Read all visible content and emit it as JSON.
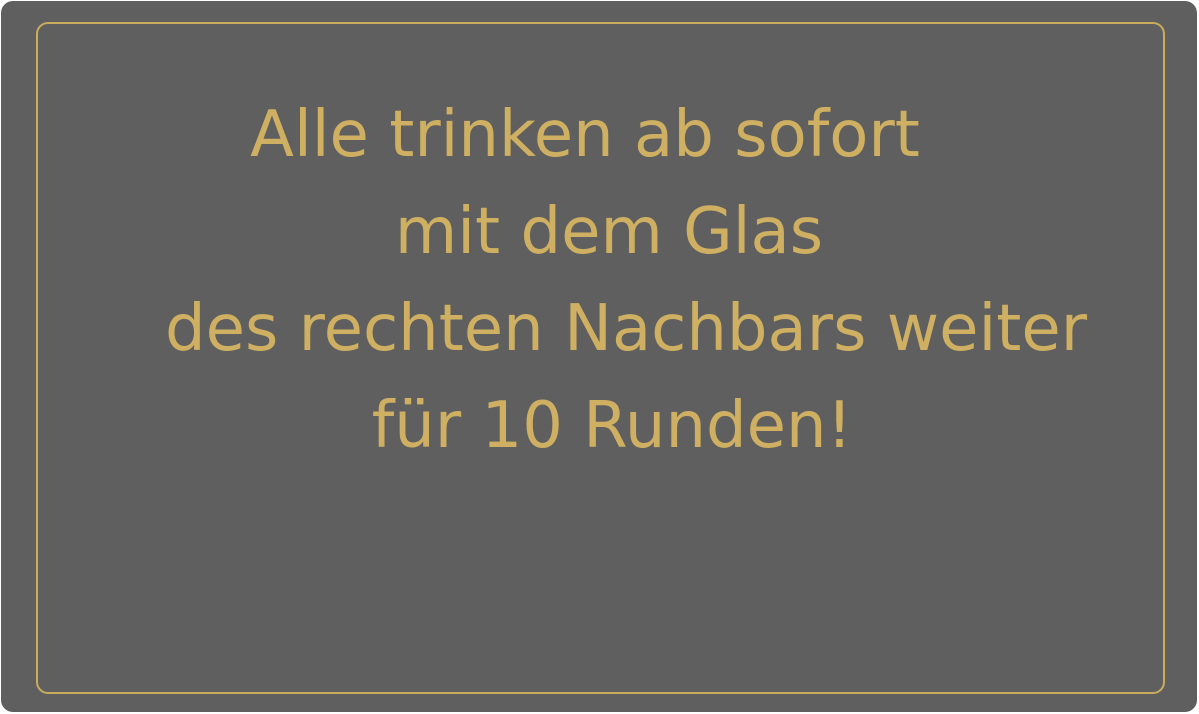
{
  "card": {
    "lines": [
      "Alle trinken ab sofort",
      "mit dem Glas",
      "des rechten Nachbars weiter",
      "für 10 Runden!"
    ]
  },
  "colors": {
    "background": "#5f5f5f",
    "accent": "#cfb062",
    "frame": "#c9ac5c"
  }
}
